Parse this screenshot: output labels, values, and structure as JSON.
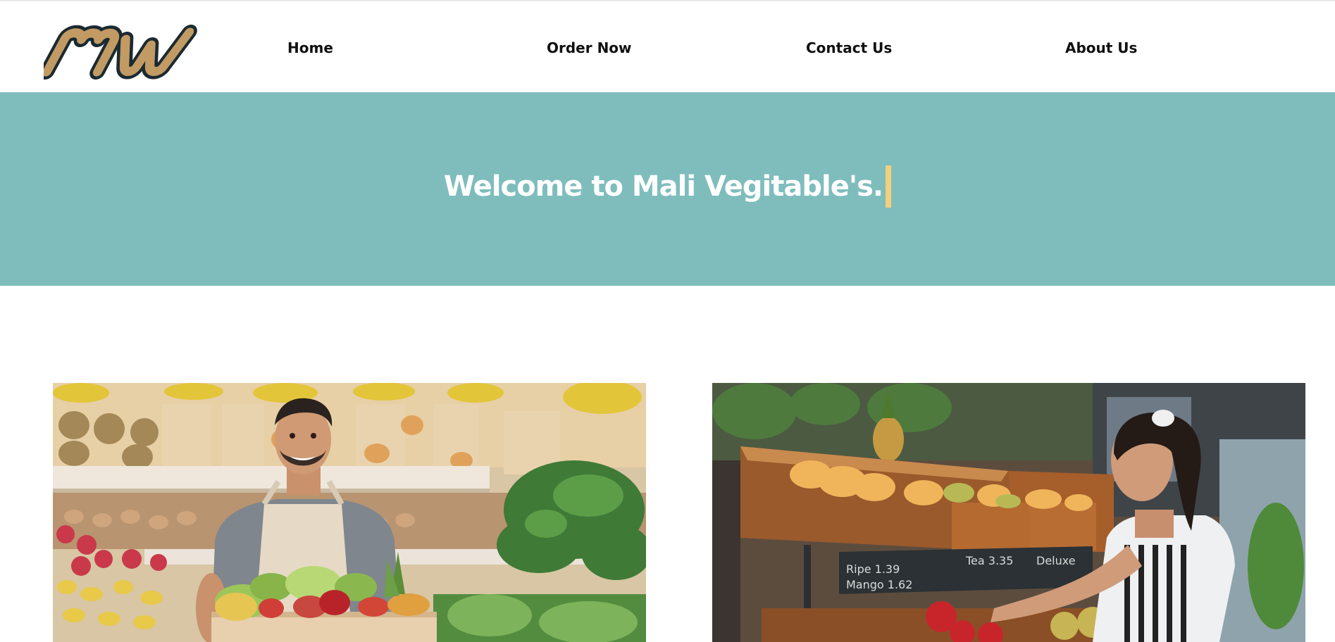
{
  "nav": {
    "logo_icon": "mw-logo-icon",
    "items": [
      {
        "label": "Home"
      },
      {
        "label": "Order Now"
      },
      {
        "label": "Contact Us"
      },
      {
        "label": "About Us"
      }
    ]
  },
  "hero": {
    "title": "Welcome to Mali Vegitable's.",
    "background_color": "#7fbdbd",
    "cursor_color": "#f2cf7c"
  },
  "images": [
    {
      "icon": "vendor-photo-icon"
    },
    {
      "icon": "shopper-photo-icon"
    }
  ],
  "colors": {
    "logo_fill": "#c19a64",
    "logo_outline": "#1b2a30"
  }
}
